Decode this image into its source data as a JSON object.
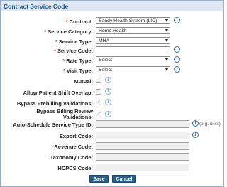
{
  "dialog": {
    "title": "Contract Service Code"
  },
  "fields": {
    "contract": {
      "label": "Contract:",
      "value": "Sandy Health System (LIC)"
    },
    "service_category": {
      "label": "Service Category:",
      "value": "Home Health"
    },
    "service_type": {
      "label": "Service Type:",
      "value": "MHA"
    },
    "service_code": {
      "label": "Service Code:",
      "value": ""
    },
    "rate_type": {
      "label": "Rate Type:",
      "value": "Select"
    },
    "visit_type": {
      "label": "Visit Type:",
      "value": "Select"
    },
    "mutual": {
      "label": "Mutual:",
      "checked": false
    },
    "allow_patient_shift_overlap": {
      "label": "Allow Patient Shift Overlap:",
      "checked": false
    },
    "bypass_prebilling": {
      "label": "Bypass Prebilling Validations:",
      "checked": true
    },
    "bypass_billing_review": {
      "label_line1": "Bypass Billing Review",
      "label_line2": "Validations:",
      "checked": true
    },
    "auto_schedule_service_type_id": {
      "label": "Auto-Schedule Service Type ID:",
      "value": "",
      "hint": "(e.g. xxxx)"
    },
    "export_code": {
      "label": "Export Code:",
      "value": ""
    },
    "revenue_code": {
      "label": "Revenue Code:",
      "value": ""
    },
    "taxonomy_code": {
      "label": "Taxonomy Code:",
      "value": ""
    },
    "hcpcs_code": {
      "label": "HCPCS Code:",
      "value": ""
    }
  },
  "required_marker": "*",
  "info_icon_glyph": "i",
  "buttons": {
    "save": "Save",
    "cancel": "Cancel"
  },
  "colors": {
    "accent": "#2a5f86",
    "title_text": "#1f5a8a",
    "required": "#d01010"
  }
}
